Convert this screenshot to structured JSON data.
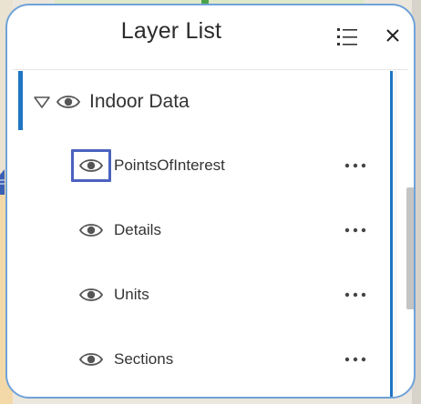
{
  "panel": {
    "title": "Layer List",
    "accent_color": "#1f75c3",
    "focus_color": "#4b62c0"
  },
  "header_icons": [
    "list-options-icon",
    "close-icon"
  ],
  "group": {
    "label": "Indoor Data",
    "expanded": true,
    "icons": [
      "caret-down-icon",
      "eye-icon"
    ]
  },
  "layers": [
    {
      "label": "PointsOfInterest",
      "focused": true
    },
    {
      "label": "Details",
      "focused": false
    },
    {
      "label": "Units",
      "focused": false
    },
    {
      "label": "Sections",
      "focused": false
    }
  ]
}
